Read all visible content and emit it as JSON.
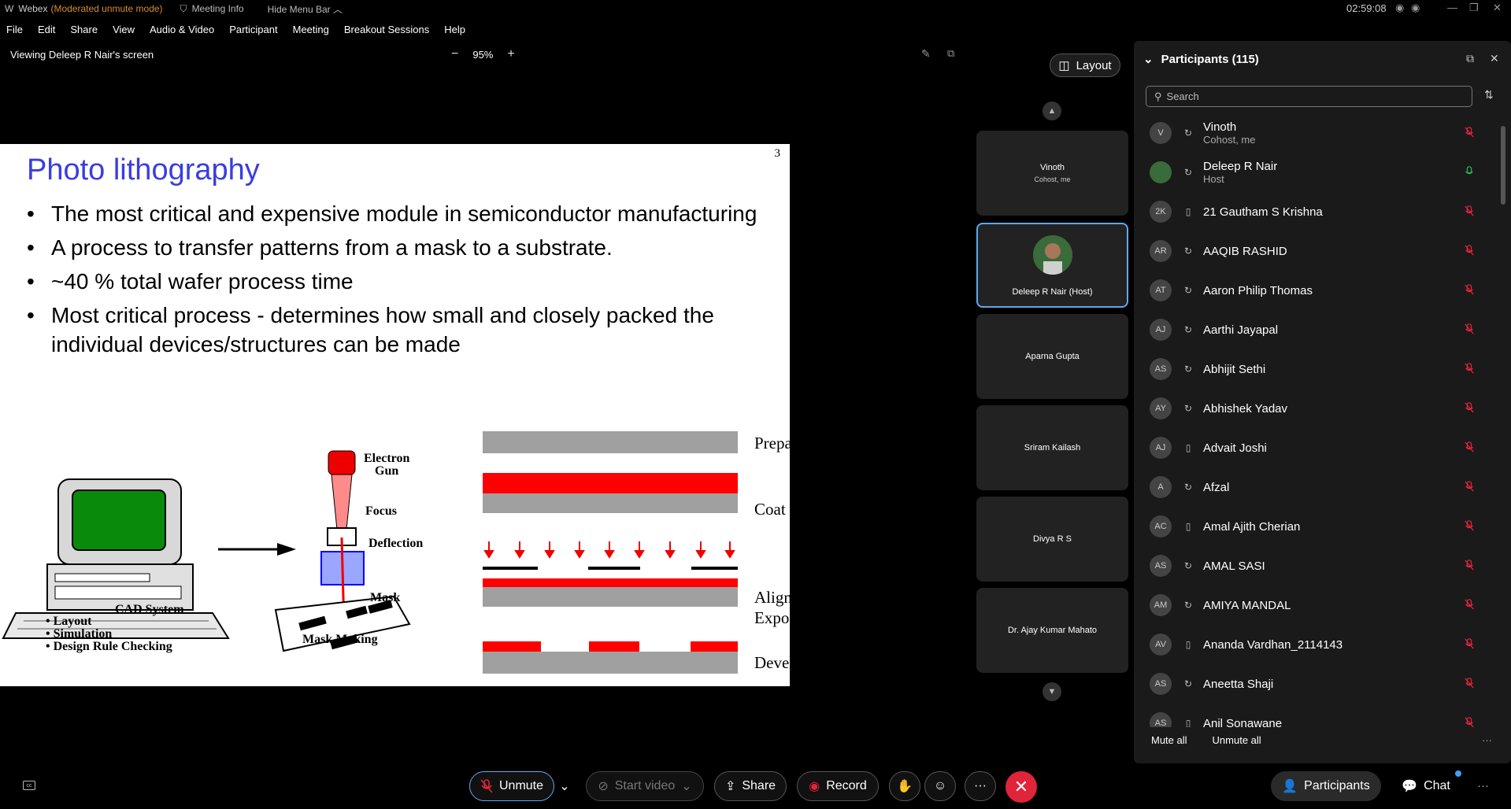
{
  "titlebar": {
    "app": "Webex",
    "mode": "(Moderated unmute mode)",
    "meeting_info": "Meeting Info",
    "hide_menu": "Hide Menu Bar",
    "clock": "02:59:08"
  },
  "menu": [
    "File",
    "Edit",
    "Share",
    "View",
    "Audio & Video",
    "Participant",
    "Meeting",
    "Breakout Sessions",
    "Help"
  ],
  "view": {
    "title": "Viewing Deleep R Nair's screen",
    "zoom": "95%"
  },
  "slide": {
    "title": "Photo lithography",
    "page": "3",
    "bullets": [
      "The most critical and expensive module in semiconductor manufacturing",
      "A process to transfer patterns from a mask to a substrate.",
      "~40 % total wafer process time",
      "Most critical process - determines how small and closely packed the individual devices/structures can be made"
    ],
    "diagram": {
      "cad_title": "CAD System",
      "cad_items": [
        "• Layout",
        "• Simulation",
        "• Design Rule Checking"
      ],
      "gun_label": "Electron",
      "gun_label2": "Gun",
      "focus": "Focus",
      "deflection": "Deflection",
      "mask": "Mask",
      "mask_making": "Mask Making",
      "steps": [
        "Prepare Wafer",
        "Coat with Photoresist",
        "Align Mask and",
        "Expose with UV light",
        "Develop"
      ]
    },
    "colors": {
      "title": "#3a3de0",
      "resist": "#ff0000",
      "wafer": "#a0a0a0",
      "screen": "#0a8a0a"
    }
  },
  "stage": {
    "layout_label": "Layout",
    "tiles": [
      {
        "name": "Vinoth",
        "sub": "Cohost, me"
      },
      {
        "name": "Deleep R Nair (Host)",
        "sub": ""
      },
      {
        "name": "Aparna Gupta",
        "sub": ""
      },
      {
        "name": "Sriram Kailash",
        "sub": ""
      },
      {
        "name": "Divya R S",
        "sub": ""
      },
      {
        "name": "Dr. Ajay Kumar Mahato",
        "sub": ""
      }
    ]
  },
  "panel": {
    "title": "Participants (115)",
    "search_placeholder": "Search",
    "participants": [
      {
        "initials": "V",
        "name": "Vinoth",
        "sub": "Cohost, me",
        "device": "sync-icon",
        "muted": true
      },
      {
        "initials": "",
        "name": "Deleep R Nair",
        "sub": "Host",
        "device": "sync-icon",
        "muted": false
      },
      {
        "initials": "2K",
        "name": "21 Gautham S Krishna",
        "sub": "",
        "device": "phone-icon",
        "muted": true
      },
      {
        "initials": "AR",
        "name": "AAQIB RASHID",
        "sub": "",
        "device": "sync-icon",
        "muted": true
      },
      {
        "initials": "AT",
        "name": "Aaron Philip Thomas",
        "sub": "",
        "device": "sync-icon",
        "muted": true
      },
      {
        "initials": "AJ",
        "name": "Aarthi Jayapal",
        "sub": "",
        "device": "sync-icon",
        "muted": true
      },
      {
        "initials": "AS",
        "name": "Abhijit Sethi",
        "sub": "",
        "device": "sync-icon",
        "muted": true
      },
      {
        "initials": "AY",
        "name": "Abhishek Yadav",
        "sub": "",
        "device": "sync-icon",
        "muted": true
      },
      {
        "initials": "AJ",
        "name": "Advait Joshi",
        "sub": "",
        "device": "phone-icon",
        "muted": true
      },
      {
        "initials": "A",
        "name": "Afzal",
        "sub": "",
        "device": "sync-icon",
        "muted": true
      },
      {
        "initials": "AC",
        "name": "Amal Ajith Cherian",
        "sub": "",
        "device": "phone-icon",
        "muted": true
      },
      {
        "initials": "AS",
        "name": "AMAL SASI",
        "sub": "",
        "device": "sync-icon",
        "muted": true
      },
      {
        "initials": "AM",
        "name": "AMIYA MANDAL",
        "sub": "",
        "device": "sync-icon",
        "muted": true
      },
      {
        "initials": "AV",
        "name": "Ananda Vardhan_2114143",
        "sub": "",
        "device": "phone-icon",
        "muted": true
      },
      {
        "initials": "AS",
        "name": "Aneetta Shaji",
        "sub": "",
        "device": "sync-icon",
        "muted": true
      },
      {
        "initials": "AS",
        "name": "Anil Sonawane",
        "sub": "",
        "device": "phone-icon",
        "muted": true
      }
    ],
    "mute_all": "Mute all",
    "unmute_all": "Unmute all"
  },
  "controls": {
    "unmute": "Unmute",
    "start_video": "Start video",
    "share": "Share",
    "record": "Record",
    "participants": "Participants",
    "chat": "Chat",
    "more": "···"
  }
}
